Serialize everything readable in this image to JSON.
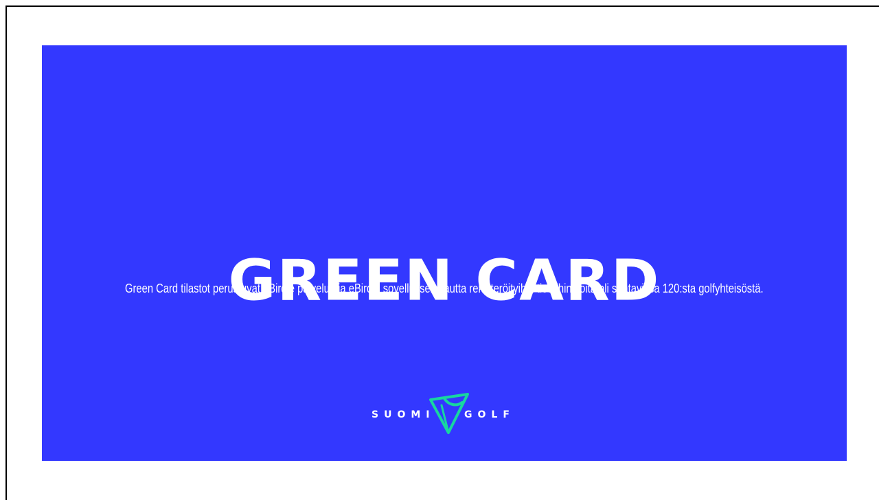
{
  "slide": {
    "title": "GREEN CARD",
    "subtitle": "Green Card tilastot perustuvat eBirdie palvelun ja eBirdie sovelluksen kautta rekisteröityihin tietoihin, joita oli saatavissa 120:sta golfyhteisöstä.",
    "logo": {
      "left_text": "SUOMI",
      "right_text": "GOLF",
      "icon": "flag-icon",
      "accent_color": "#18d6a0"
    },
    "background_color": "#3338ff"
  }
}
